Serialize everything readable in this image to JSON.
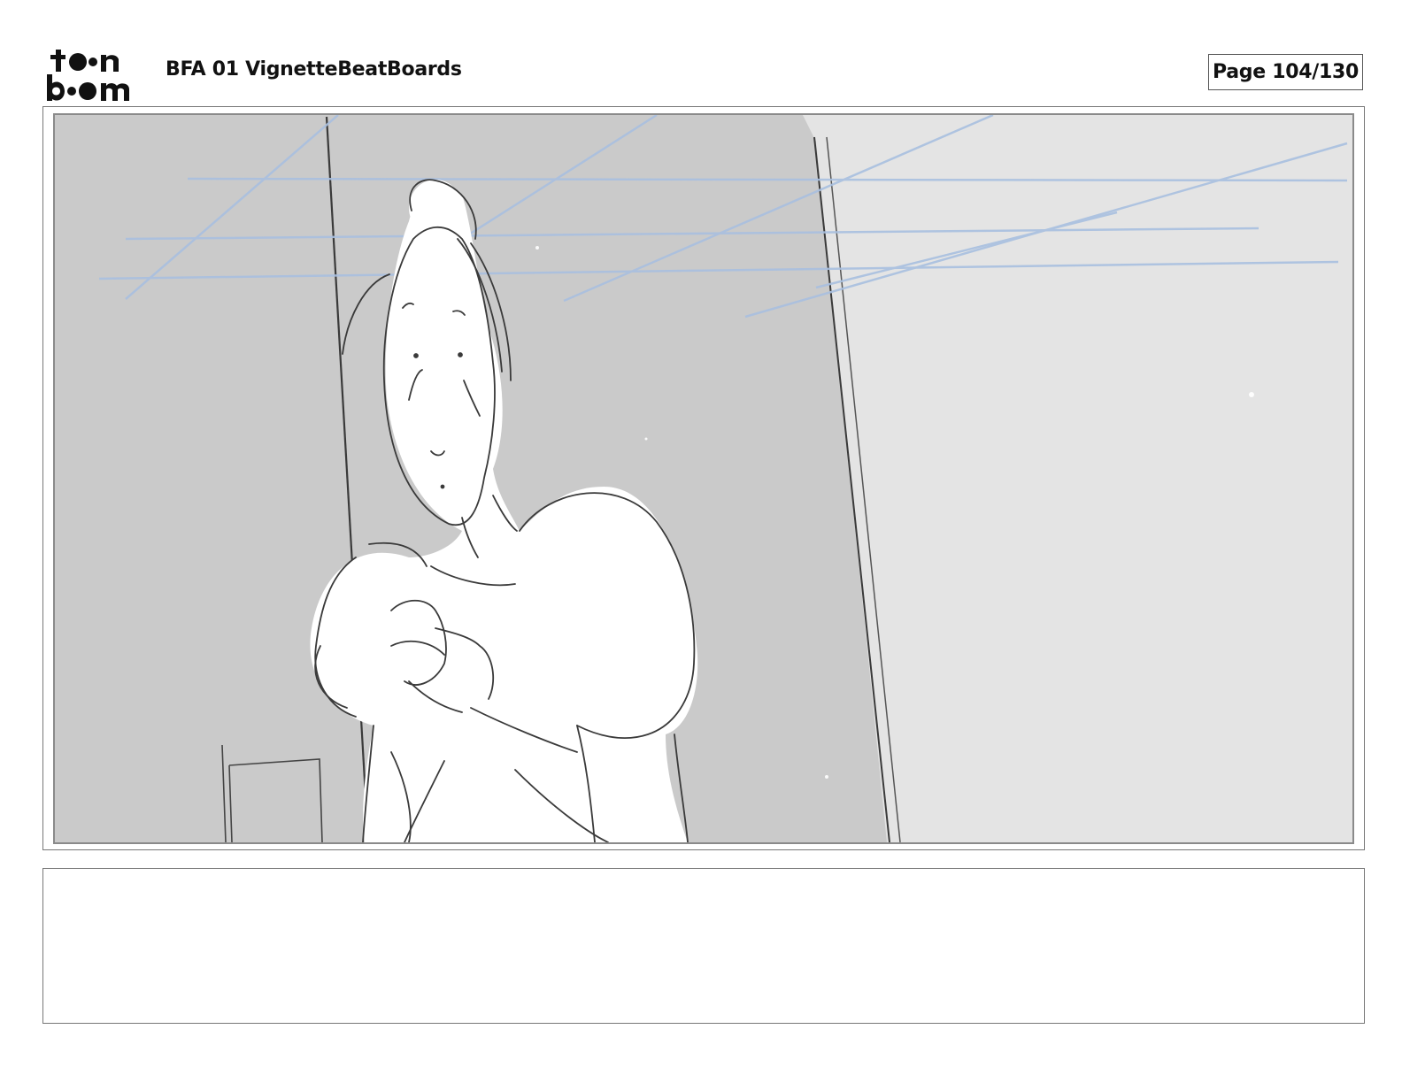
{
  "header": {
    "logo_alt": "toon boom",
    "document_title": "BFA 01 VignetteBeatBoards",
    "page_label": "Page 104/130"
  },
  "panel": {
    "image_name": "storyboard-sketch"
  },
  "notes": {
    "text": ""
  },
  "colors": {
    "bg_dark": "#cacaca",
    "bg_light": "#e4e4e4",
    "blue_lines": "#a9c0e0",
    "pencil": "#3a3a3a"
  }
}
